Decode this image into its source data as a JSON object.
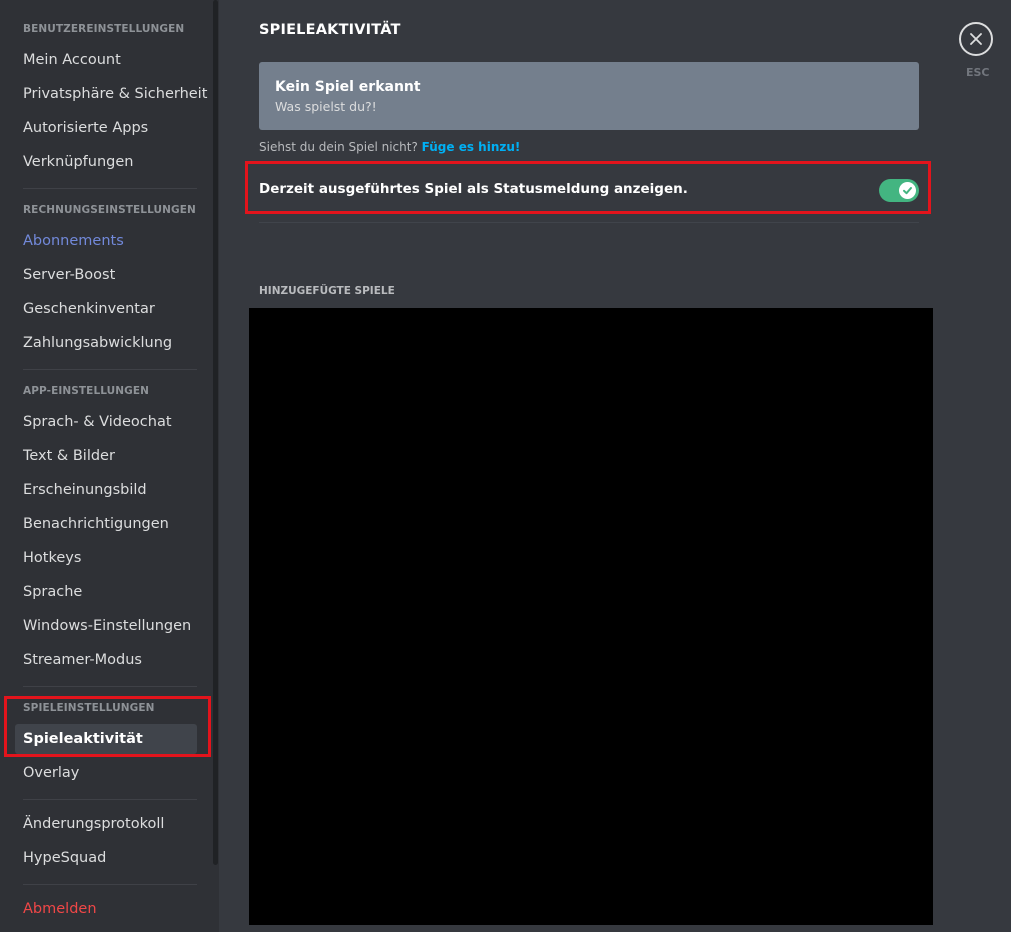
{
  "sidebar": {
    "sections": [
      {
        "header": "BENUTZEREINSTELLUNGEN",
        "items": [
          "Mein Account",
          "Privatsphäre & Sicherheit",
          "Autorisierte Apps",
          "Verknüpfungen"
        ]
      },
      {
        "header": "RECHNUNGSEINSTELLUNGEN",
        "items": [
          "Abonnements",
          "Server-Boost",
          "Geschenkinventar",
          "Zahlungsabwicklung"
        ]
      },
      {
        "header": "APP-EINSTELLUNGEN",
        "items": [
          "Sprach- & Videochat",
          "Text & Bilder",
          "Erscheinungsbild",
          "Benachrichtigungen",
          "Hotkeys",
          "Sprache",
          "Windows-Einstellungen",
          "Streamer-Modus"
        ]
      },
      {
        "header": "SPIELEINSTELLUNGEN",
        "items": [
          "Spieleaktivität",
          "Overlay"
        ]
      }
    ],
    "extra_items": [
      "Änderungsprotokoll",
      "HypeSquad"
    ],
    "logout": "Abmelden",
    "selected": "Spieleaktivität"
  },
  "main": {
    "title": "SPIELEAKTIVITÄT",
    "detected": {
      "title": "Kein Spiel erkannt",
      "subtitle": "Was spielst du?!"
    },
    "missing_prompt": "Siehst du dein Spiel nicht?",
    "missing_link": "Füge es hinzu!",
    "status_toggle": {
      "label": "Derzeit ausgeführtes Spiel als Statusmeldung anzeigen.",
      "enabled": true
    },
    "added_games_header": "HINZUGEFÜGTE SPIELE"
  },
  "close": {
    "label": "ESC"
  },
  "colors": {
    "sidebar_bg": "#2f3136",
    "main_bg": "#36393f",
    "accent": "#7289da",
    "danger": "#f04747",
    "toggle_on": "#43b581",
    "link": "#00b0f4",
    "highlight": "#e3141c"
  }
}
